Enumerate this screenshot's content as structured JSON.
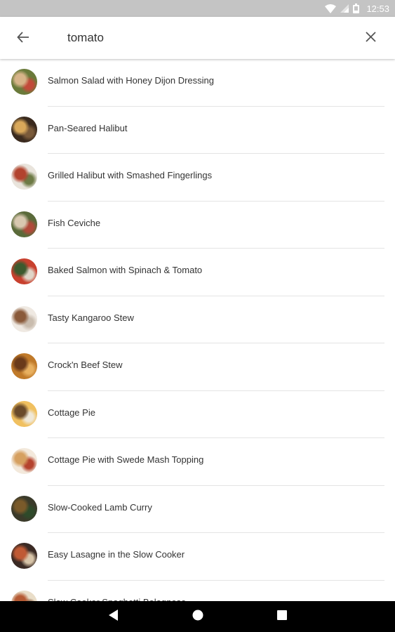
{
  "status_bar": {
    "time": "12:53",
    "icons": [
      "wifi-icon",
      "signal-icon",
      "battery-icon"
    ]
  },
  "search": {
    "query": "tomato",
    "back_icon": "arrow-back-icon",
    "clear_icon": "close-icon"
  },
  "results": [
    {
      "label": "Salmon Salad with Honey Dijon Dressing",
      "colors": [
        "#6a7a3a",
        "#d7b489",
        "#c24a3a"
      ]
    },
    {
      "label": "Pan-Seared Halibut",
      "colors": [
        "#3a2a1e",
        "#d9a85a",
        "#7a5a3a"
      ]
    },
    {
      "label": "Grilled Halibut with Smashed Fingerlings",
      "colors": [
        "#e9e4dc",
        "#b2432e",
        "#6d7a45"
      ]
    },
    {
      "label": "Fish Ceviche",
      "colors": [
        "#5a6a3a",
        "#d8c8b0",
        "#b04a3a"
      ]
    },
    {
      "label": "Baked Salmon with Spinach & Tomato",
      "colors": [
        "#c8402e",
        "#3c5a2e",
        "#e0d6c8"
      ]
    },
    {
      "label": "Tasty Kangaroo Stew",
      "colors": [
        "#efe9e2",
        "#8a5a3a",
        "#c9bcae"
      ]
    },
    {
      "label": "Crock'n Beef Stew",
      "colors": [
        "#c07a2a",
        "#6a3a1a",
        "#e8b060"
      ]
    },
    {
      "label": "Cottage Pie",
      "colors": [
        "#f0c060",
        "#6a4a2a",
        "#efe8d8"
      ]
    },
    {
      "label": "Cottage Pie with Swede Mash Topping",
      "colors": [
        "#f3e9dc",
        "#d6a060",
        "#b5432e"
      ]
    },
    {
      "label": "Slow-Cooked Lamb Curry",
      "colors": [
        "#3a3a2a",
        "#7a5a2a",
        "#2e4a2a"
      ]
    },
    {
      "label": "Easy Lasagne in the Slow Cooker",
      "colors": [
        "#3a2a24",
        "#c05a34",
        "#d7c4a8"
      ]
    },
    {
      "label": "Slow Cooker Spaghetti Bolognese",
      "colors": [
        "#e9ddc8",
        "#b55a34",
        "#7a4a2a"
      ]
    }
  ],
  "nav_bar": {
    "icons": [
      "back-triangle-icon",
      "home-circle-icon",
      "recents-square-icon"
    ]
  },
  "colors": {
    "status_bar": "#c4c4c4",
    "text": "#333333",
    "divider": "#e4e4e4"
  }
}
